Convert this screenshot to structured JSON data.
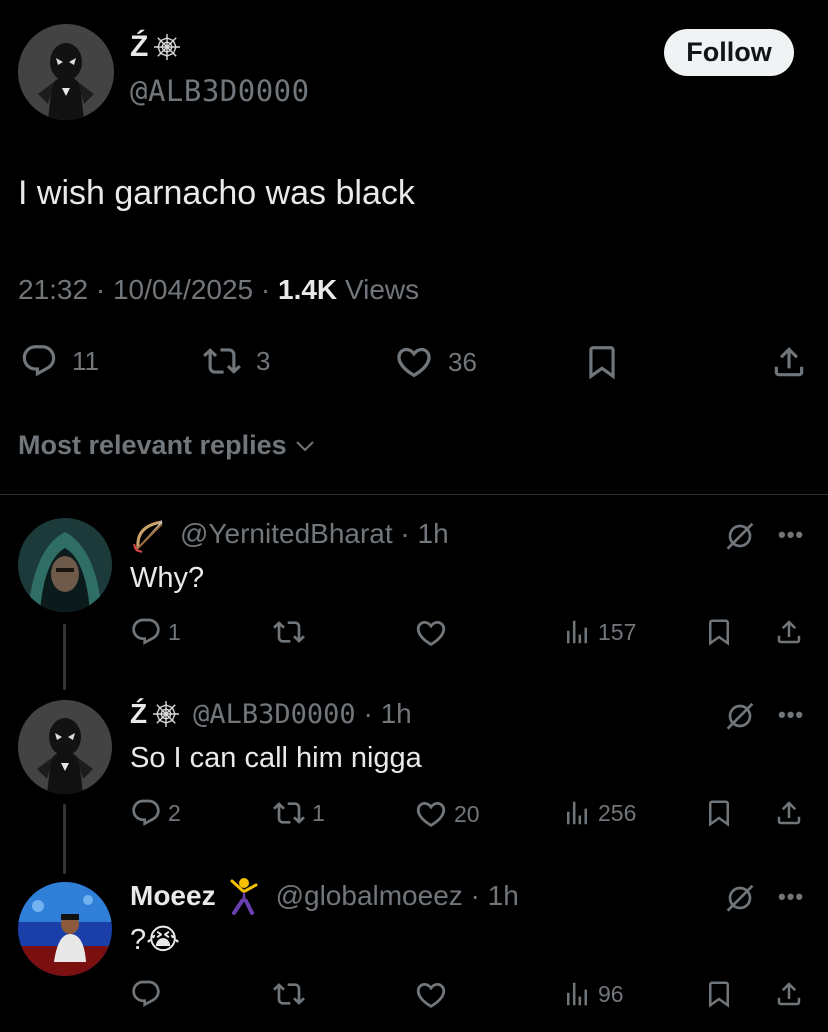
{
  "tweet": {
    "display_name": "Ź",
    "handle": "@ALB3D0000",
    "follow_label": "Follow",
    "text": "I wish garnacho was black",
    "time": "21:32",
    "date": "10/04/2025",
    "views_count": "1.4K",
    "views_label": "Views",
    "replies": "11",
    "reposts": "3",
    "likes": "36"
  },
  "replies_section": {
    "title": "Most relevant replies"
  },
  "replies": [
    {
      "display_name": "",
      "handle": "@YernitedBharat",
      "time": "1h",
      "text": "Why?",
      "replies": "1",
      "reposts": "",
      "likes": "",
      "views": "157",
      "name_icon": "bow-and-arrow-icon"
    },
    {
      "display_name": "Ź",
      "handle": "@ALB3D0000",
      "time": "1h",
      "text": "So I can call him nigga",
      "replies": "2",
      "reposts": "1",
      "likes": "20",
      "views": "256",
      "name_icon": "spiderweb-icon"
    },
    {
      "display_name": "Moeez",
      "handle": "@globalmoeez",
      "time": "1h",
      "text": "?😭",
      "replies": "",
      "reposts": "",
      "likes": "",
      "views": "96",
      "name_icon": "dancer-emoji-icon"
    }
  ],
  "colors": {
    "background": "#000000",
    "text_primary": "#e7e9ea",
    "text_secondary": "#71767b",
    "divider": "#2f3336",
    "follow_bg": "#eff3f4"
  }
}
